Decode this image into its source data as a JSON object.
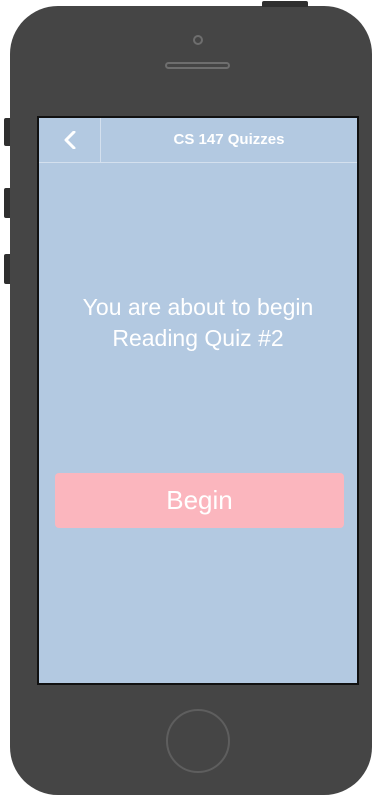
{
  "navbar": {
    "back_icon": "chevron-left-icon",
    "title": "CS 147 Quizzes"
  },
  "main": {
    "message_line1": "You are about to begin",
    "message_line2": "Reading Quiz #2",
    "begin_label": "Begin"
  },
  "colors": {
    "screen_background": "#b3c9e1",
    "button_background": "#fbb6be",
    "text": "#ffffff",
    "device_body": "#454545"
  }
}
